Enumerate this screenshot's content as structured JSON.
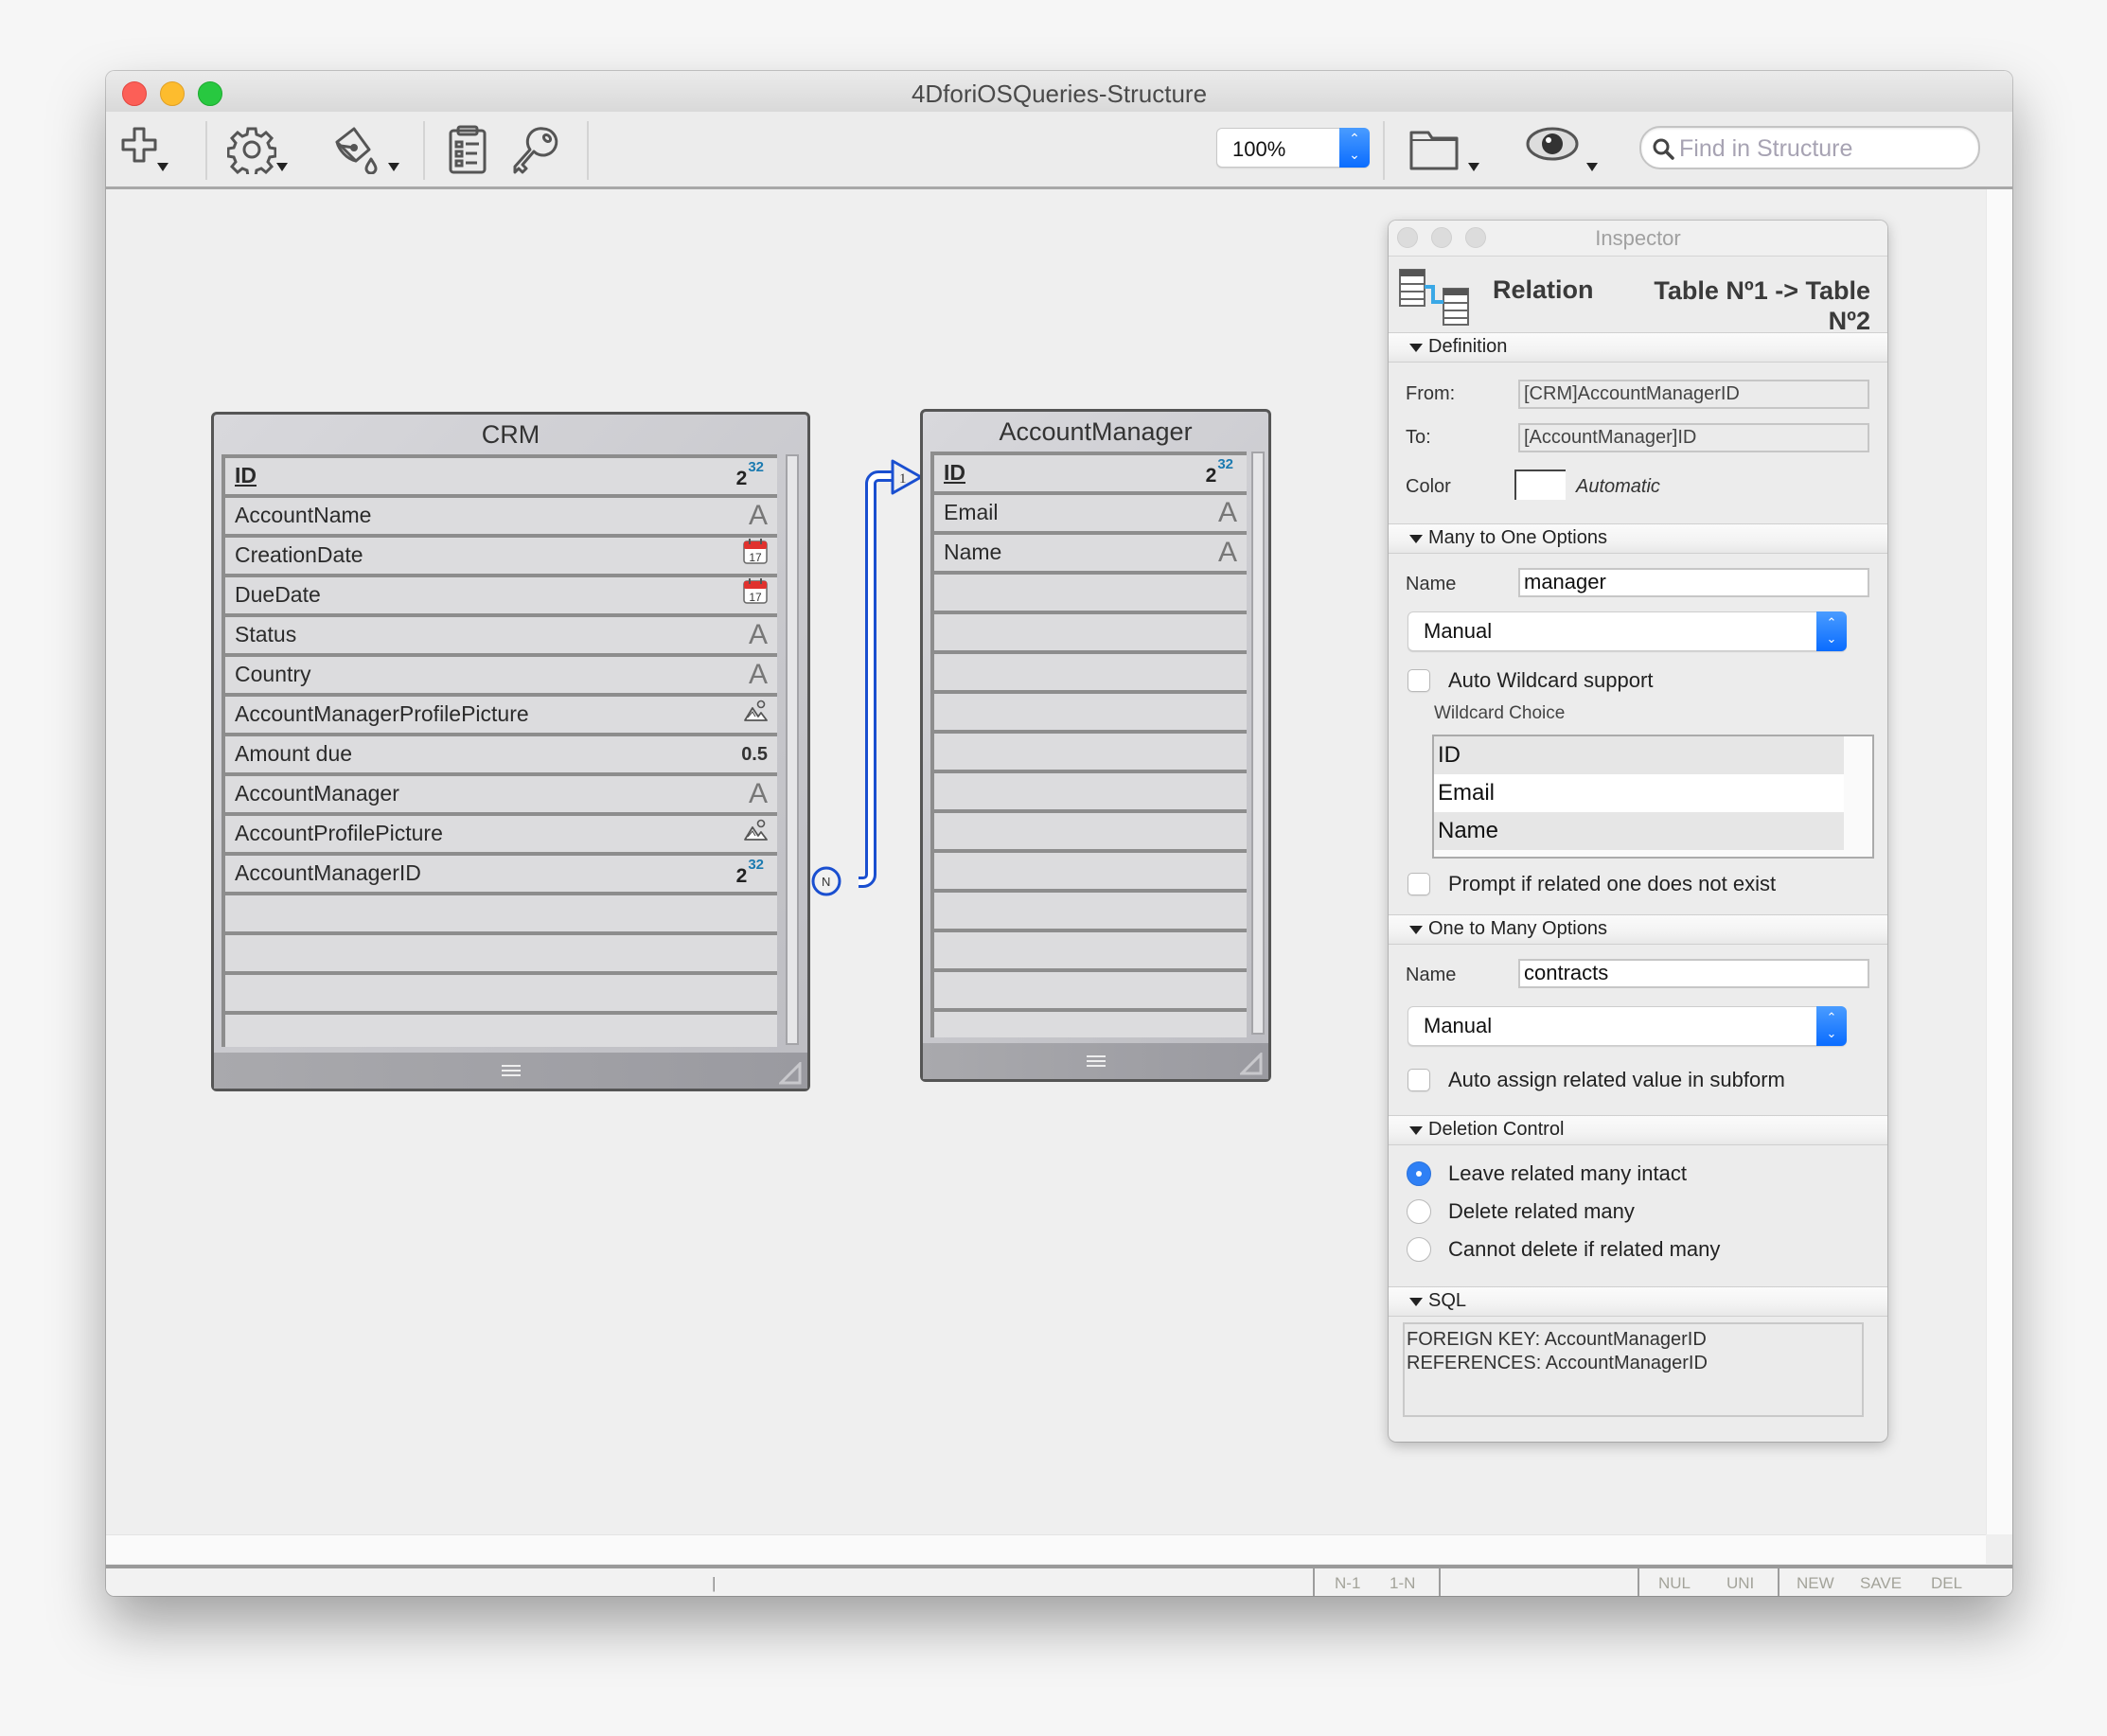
{
  "window": {
    "title": "4DforiOSQueries-Structure"
  },
  "toolbar": {
    "add_icon": "plus-icon",
    "settings_icon": "gear-icon",
    "paint_icon": "paint-bucket-icon",
    "list_icon": "clipboard-list-icon",
    "key_icon": "key-icon",
    "zoom_value": "100%",
    "folder_icon": "folder-icon",
    "eye_icon": "eye-icon",
    "search_placeholder": "Find in Structure"
  },
  "tables": [
    {
      "name": "CRM",
      "fields": [
        {
          "name": "ID",
          "type": "integer",
          "primary_key": true
        },
        {
          "name": "AccountName",
          "type": "alpha"
        },
        {
          "name": "CreationDate",
          "type": "date"
        },
        {
          "name": "DueDate",
          "type": "date"
        },
        {
          "name": "Status",
          "type": "alpha"
        },
        {
          "name": "Country",
          "type": "alpha"
        },
        {
          "name": "AccountManagerProfilePicture",
          "type": "picture"
        },
        {
          "name": "Amount due",
          "type": "real"
        },
        {
          "name": "AccountManager",
          "type": "alpha"
        },
        {
          "name": "AccountProfilePicture",
          "type": "picture"
        },
        {
          "name": "AccountManagerID",
          "type": "integer"
        }
      ],
      "empty_rows": 4
    },
    {
      "name": "AccountManager",
      "fields": [
        {
          "name": "ID",
          "type": "integer",
          "primary_key": true
        },
        {
          "name": "Email",
          "type": "alpha"
        },
        {
          "name": "Name",
          "type": "alpha"
        }
      ],
      "empty_rows": 12
    }
  ],
  "type_glyphs": {
    "integer_base": "2",
    "integer_exp": "32",
    "alpha": "A",
    "real": "0.5",
    "date_day": "17"
  },
  "relation": {
    "many_label": "N",
    "one_label": "1",
    "color": "#1a4fd0"
  },
  "inspector": {
    "title": "Inspector",
    "kind": "Relation",
    "relation_title": "Table Nº1 -> Table Nº2",
    "sections": {
      "definition": "Definition",
      "many_to_one": "Many to One Options",
      "one_to_many": "One to Many Options",
      "deletion": "Deletion Control",
      "sql": "SQL"
    },
    "definition": {
      "from_label": "From:",
      "from_value": "[CRM]AccountManagerID",
      "to_label": "To:",
      "to_value": "[AccountManager]ID",
      "color_label": "Color",
      "color_value": "Automatic"
    },
    "many_to_one": {
      "name_label": "Name",
      "name_value": "manager",
      "mode": "Manual",
      "auto_wildcard_label": "Auto Wildcard support",
      "auto_wildcard_checked": false,
      "wildcard_choice_label": "Wildcard Choice",
      "wildcard_choices": [
        "ID",
        "Email",
        "Name"
      ],
      "prompt_label": "Prompt if related one does not exist",
      "prompt_checked": false
    },
    "one_to_many": {
      "name_label": "Name",
      "name_value": "contracts",
      "mode": "Manual",
      "auto_assign_label": "Auto assign related value in subform",
      "auto_assign_checked": false
    },
    "deletion": {
      "options": [
        {
          "label": "Leave related many intact",
          "selected": true
        },
        {
          "label": "Delete related many",
          "selected": false
        },
        {
          "label": "Cannot delete if related many",
          "selected": false
        }
      ]
    },
    "sql": {
      "text": "FOREIGN KEY: AccountManagerID\nREFERENCES: AccountManagerID"
    }
  },
  "statusbar": {
    "cursor_marker": "|",
    "n1": "N-1",
    "1n": "1-N",
    "nul": "NUL",
    "uni": "UNI",
    "new": "NEW",
    "save": "SAVE",
    "del": "DEL"
  }
}
